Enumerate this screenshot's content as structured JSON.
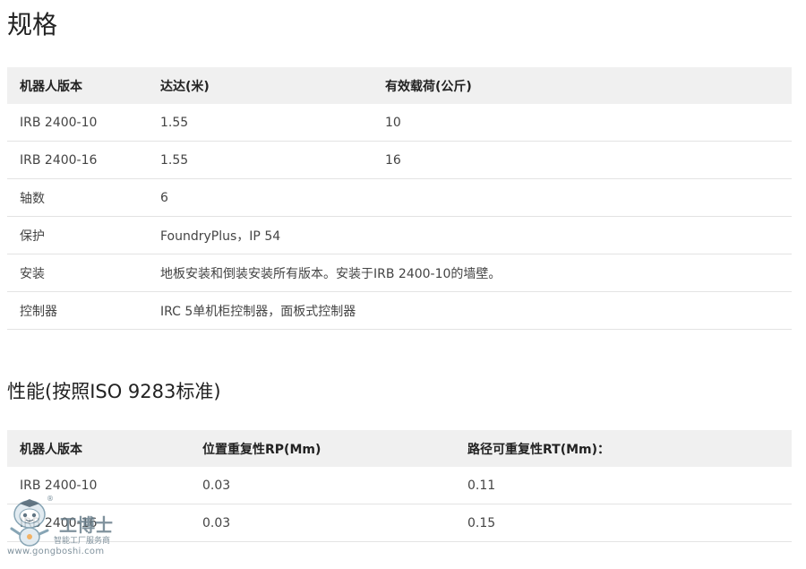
{
  "specs": {
    "title": "规格",
    "headers": [
      "机器人版本",
      "达达(米)",
      "有效载荷(公斤)"
    ],
    "rows": [
      [
        "IRB 2400-10",
        "1.55",
        "10"
      ],
      [
        "IRB 2400-16",
        "1.55",
        "16"
      ]
    ],
    "wide_rows": [
      [
        "轴数",
        "6"
      ],
      [
        "保护",
        "FoundryPlus，IP 54"
      ],
      [
        "安装",
        "地板安装和倒装安装所有版本。安装于IRB 2400-10的墙壁。"
      ],
      [
        "控制器",
        "IRC 5单机柜控制器，面板式控制器"
      ]
    ]
  },
  "performance": {
    "title": "性能(按照ISO 9283标准)",
    "headers": [
      "机器人版本",
      "位置重复性RP(Mm)",
      "路径可重复性RT(Mm)："
    ],
    "rows": [
      [
        "IRB 2400-10",
        "0.03",
        "0.11"
      ],
      [
        "IRB 2400-16",
        "0.03",
        "0.15"
      ]
    ]
  },
  "watermark": {
    "brand": "工博士",
    "registered": "®",
    "tagline": "智能工厂服务商",
    "url": "www.gongboshi.com",
    "icon": "robot-mascot-icon"
  }
}
